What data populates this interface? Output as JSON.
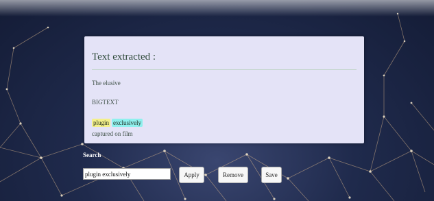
{
  "panel": {
    "title": "Text extracted :",
    "lines": [
      "The elusive",
      "BIGTEXT",
      "captured on film"
    ],
    "highlights": [
      {
        "text": "plugin",
        "color": "#f4f08a"
      },
      {
        "text": "exclusively",
        "color": "#8ff0ee"
      }
    ]
  },
  "search": {
    "label": "Search",
    "value": "plugin exclusively"
  },
  "buttons": {
    "apply": "Apply",
    "remove": "Remove",
    "save": "Save"
  },
  "colors": {
    "panel_background": "#e4e3f7",
    "panel_text": "#3d4f45",
    "background": "#1f2a4c",
    "network_lines": "#d9b48a"
  }
}
